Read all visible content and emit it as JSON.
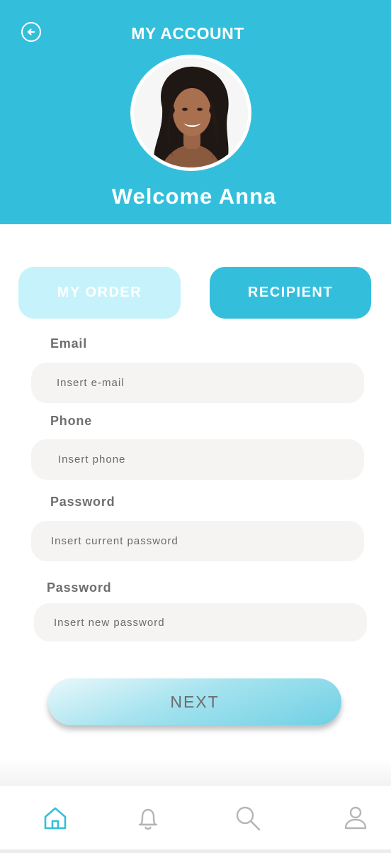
{
  "header": {
    "title": "MY ACCOUNT",
    "welcome": "Welcome Anna",
    "back_icon": "back-arrow-icon",
    "background": "#33bfdc"
  },
  "tabs": [
    {
      "label": "MY ORDER",
      "active": false
    },
    {
      "label": "RECIPIENT",
      "active": true
    }
  ],
  "form": {
    "fields": [
      {
        "label": "Email",
        "placeholder": "Insert e-mail",
        "value": ""
      },
      {
        "label": "Phone",
        "placeholder": "Insert phone",
        "value": ""
      },
      {
        "label": "Password",
        "placeholder": "Insert current password",
        "value": ""
      },
      {
        "label": "Password",
        "placeholder": "Insert new password",
        "value": ""
      }
    ],
    "submit_label": "NEXT"
  },
  "bottom_nav": {
    "items": [
      {
        "icon": "home-icon",
        "active": true
      },
      {
        "icon": "bell-icon",
        "active": false
      },
      {
        "icon": "search-icon",
        "active": false
      },
      {
        "icon": "user-icon",
        "active": false
      }
    ],
    "active_color": "#33bfdc",
    "inactive_color": "#b5b5b5"
  }
}
